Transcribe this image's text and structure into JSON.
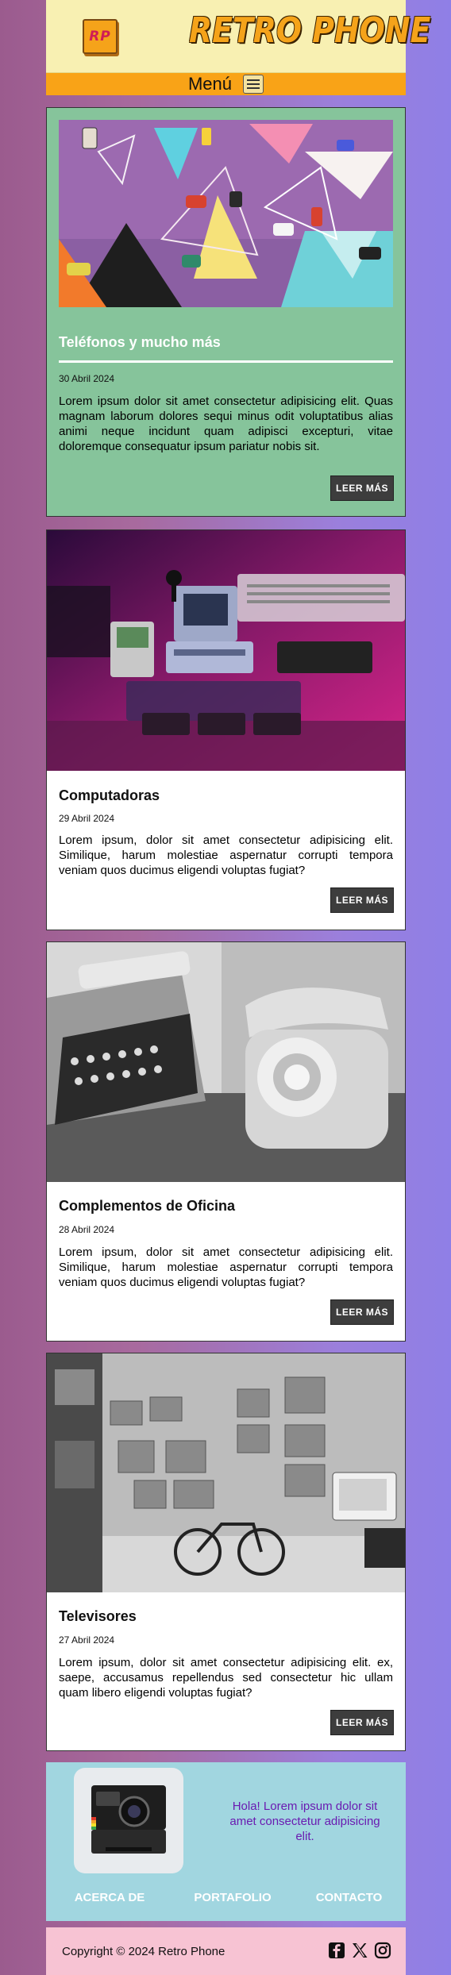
{
  "header": {
    "logo_text": "RP",
    "brand": "Retro Phone",
    "menu_label": "Menú"
  },
  "articles": [
    {
      "title": "Teléfonos y mucho más",
      "date": "30 Abril 2024",
      "body": "Lorem ipsum dolor sit amet consectetur adipisicing elit. Quas magnam laborum dolores sequi minus odit voluptatibus alias animi neque incidunt quam adipisci excepturi, vitae doloremque consequatur ipsum pariatur nobis sit.",
      "button": "LEER MÁS"
    },
    {
      "title": "Computadoras",
      "date": "29 Abril 2024",
      "body": "Lorem ipsum, dolor sit amet consectetur adipisicing elit. Similique, harum molestiae aspernatur corrupti tempora veniam quos ducimus eligendi voluptas fugiat?",
      "button": "LEER MÁS"
    },
    {
      "title": "Complementos de Oficina",
      "date": "28 Abril 2024",
      "body": "Lorem ipsum, dolor sit amet consectetur adipisicing elit. Similique, harum molestiae aspernatur corrupti tempora veniam quos ducimus eligendi voluptas fugiat?",
      "button": "LEER MÁS"
    },
    {
      "title": "Televisores",
      "date": "27 Abril 2024",
      "body": "Lorem ipsum, dolor sit amet consectetur adipisicing elit. ex, saepe, accusamus repellendus sed consectetur hic ullam quam libero eligendi voluptas fugiat?",
      "button": "LEER MÁS"
    }
  ],
  "footer": {
    "message": "Hola! Lorem ipsum dolor sit amet consectetur adipisicing elit.",
    "nav": [
      "ACERCA DE",
      "PORTAFOLIO",
      "CONTACTO"
    ],
    "copyright": "Copyright © 2024 Retro Phone",
    "social_icons": [
      "facebook-icon",
      "x-icon",
      "instagram-icon"
    ]
  },
  "colors": {
    "header_bg": "#f8f0b2",
    "menu_bg": "#f9a317",
    "featured_card_bg": "#86c49b",
    "button_bg": "#3d3d3d",
    "footer_bg": "#a1d6e0",
    "footer_msg": "#6a1bb1",
    "copyright_bg": "#f7c3d3"
  }
}
